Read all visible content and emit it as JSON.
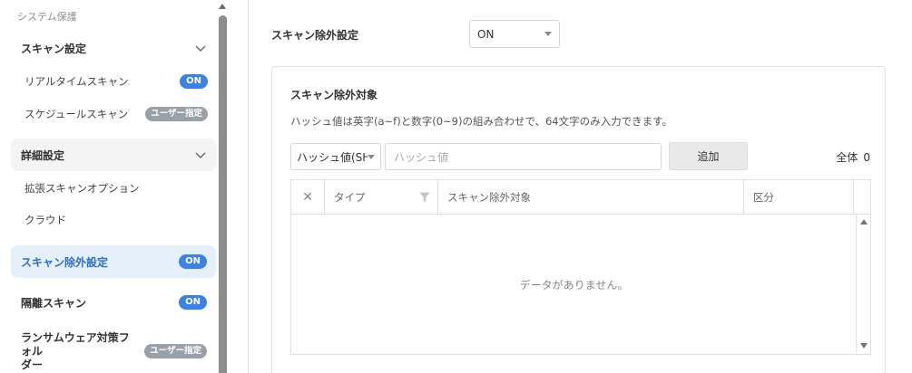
{
  "sidebar": {
    "section_title": "システム保護",
    "groups": [
      {
        "label": "スキャン設定"
      },
      {
        "label": "詳細設定"
      },
      {
        "label": "スキャン除外設定",
        "badge": "ON"
      },
      {
        "label": "隔離スキャン",
        "badge": "ON"
      },
      {
        "label_line1": "ランサムウェア対策フォル",
        "label_line2": "ダー",
        "badge": "ユーザー指定"
      }
    ],
    "items": [
      {
        "label": "リアルタイムスキャン",
        "badge": "ON"
      },
      {
        "label": "スケジュールスキャン",
        "badge": "ユーザー指定"
      },
      {
        "label": "拡張スキャンオプション"
      },
      {
        "label": "クラウド"
      }
    ]
  },
  "main": {
    "exclusion_setting_label": "スキャン除外設定",
    "exclusion_setting_value": "ON",
    "panel": {
      "title": "スキャン除外対象",
      "description": "ハッシュ値は英字(a~f)と数字(0~9)の組み合わせで、64文字のみ入力できます。",
      "type_select_value": "ハッシュ値(SH",
      "hash_placeholder": "ハッシュ値",
      "add_button": "追加",
      "total_label": "全体",
      "total_count": "0",
      "table": {
        "columns": [
          "タイプ",
          "スキャン除外対象",
          "区分"
        ],
        "empty_message": "データがありません。"
      }
    }
  },
  "colors": {
    "accent": "#3b82e6",
    "active_bg": "#e6f0fb",
    "badge_gray": "#9aa0a8"
  }
}
